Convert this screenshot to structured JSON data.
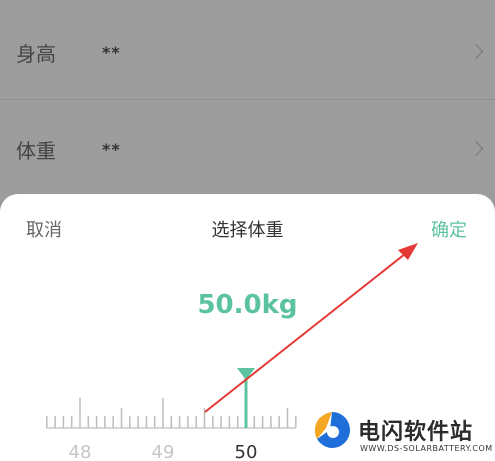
{
  "profile_rows": [
    {
      "label": "身高",
      "value": "**"
    },
    {
      "label": "体重",
      "value": "**"
    }
  ],
  "picker": {
    "cancel_label": "取消",
    "title": "选择体重",
    "confirm_label": "确定",
    "value_text": "50.0kg",
    "ruler_labels": [
      "48",
      "49",
      "50"
    ],
    "selected_value": 50.0,
    "accent_color": "#5cc3a0"
  },
  "annotation": {
    "arrow_color": "#e53935"
  },
  "watermark": {
    "name": "电闪软件站",
    "url": "WWW.DS-SOLARBATTERY.COM"
  }
}
